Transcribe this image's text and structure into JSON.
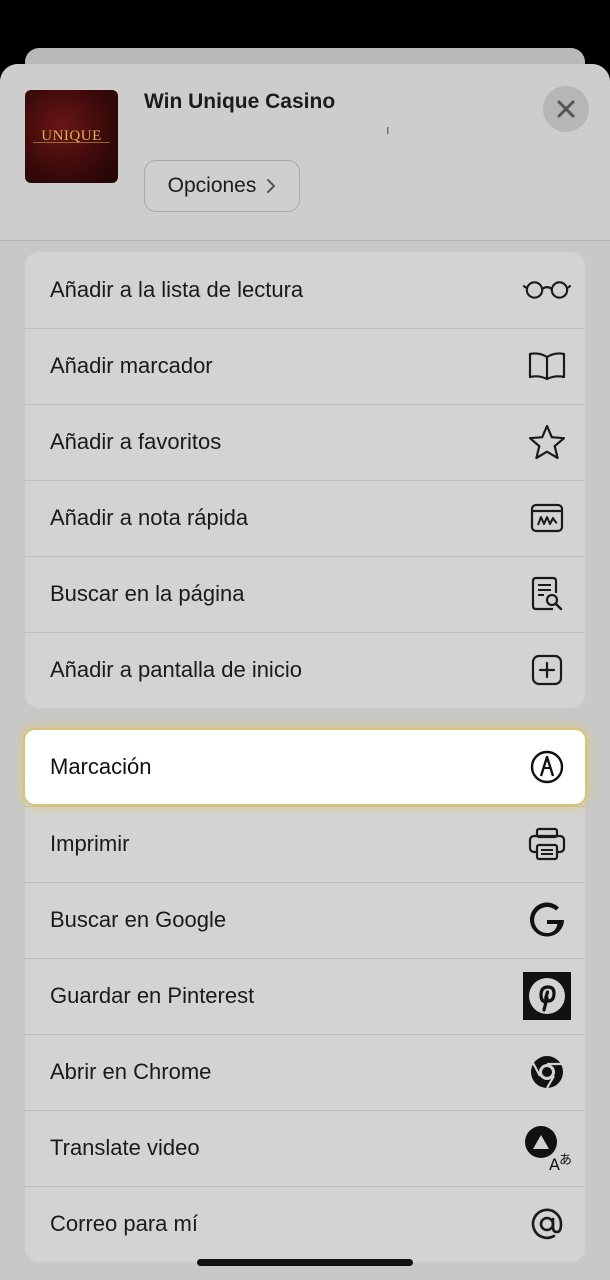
{
  "header": {
    "site_title": "Win Unique Casino",
    "site_sub": "ı",
    "logo_text": "UNIQUE",
    "options_label": "Opciones"
  },
  "actions_primary": [
    {
      "label": "Añadir a la lista de lectura",
      "icon": "reading-glasses-icon"
    },
    {
      "label": "Añadir marcador",
      "icon": "book-icon"
    },
    {
      "label": "Añadir a favoritos",
      "icon": "star-icon"
    },
    {
      "label": "Añadir a nota rápida",
      "icon": "quick-note-icon"
    },
    {
      "label": "Buscar en la página",
      "icon": "find-in-page-icon"
    },
    {
      "label": "Añadir a pantalla de inicio",
      "icon": "add-square-icon"
    }
  ],
  "highlighted": {
    "label": "Marcación",
    "icon": "markup-pen-icon"
  },
  "actions_secondary": [
    {
      "label": "Imprimir",
      "icon": "printer-icon"
    },
    {
      "label": "Buscar en Google",
      "icon": "google-icon"
    },
    {
      "label": "Guardar en Pinterest",
      "icon": "pinterest-icon"
    },
    {
      "label": "Abrir en Chrome",
      "icon": "chrome-icon"
    },
    {
      "label": "Translate video",
      "icon": "translate-icon"
    },
    {
      "label": "Correo para mí",
      "icon": "at-sign-icon"
    }
  ],
  "colors": {
    "highlight_glow": "#d7c27a",
    "sheet_bg": "#c8c8c8"
  }
}
